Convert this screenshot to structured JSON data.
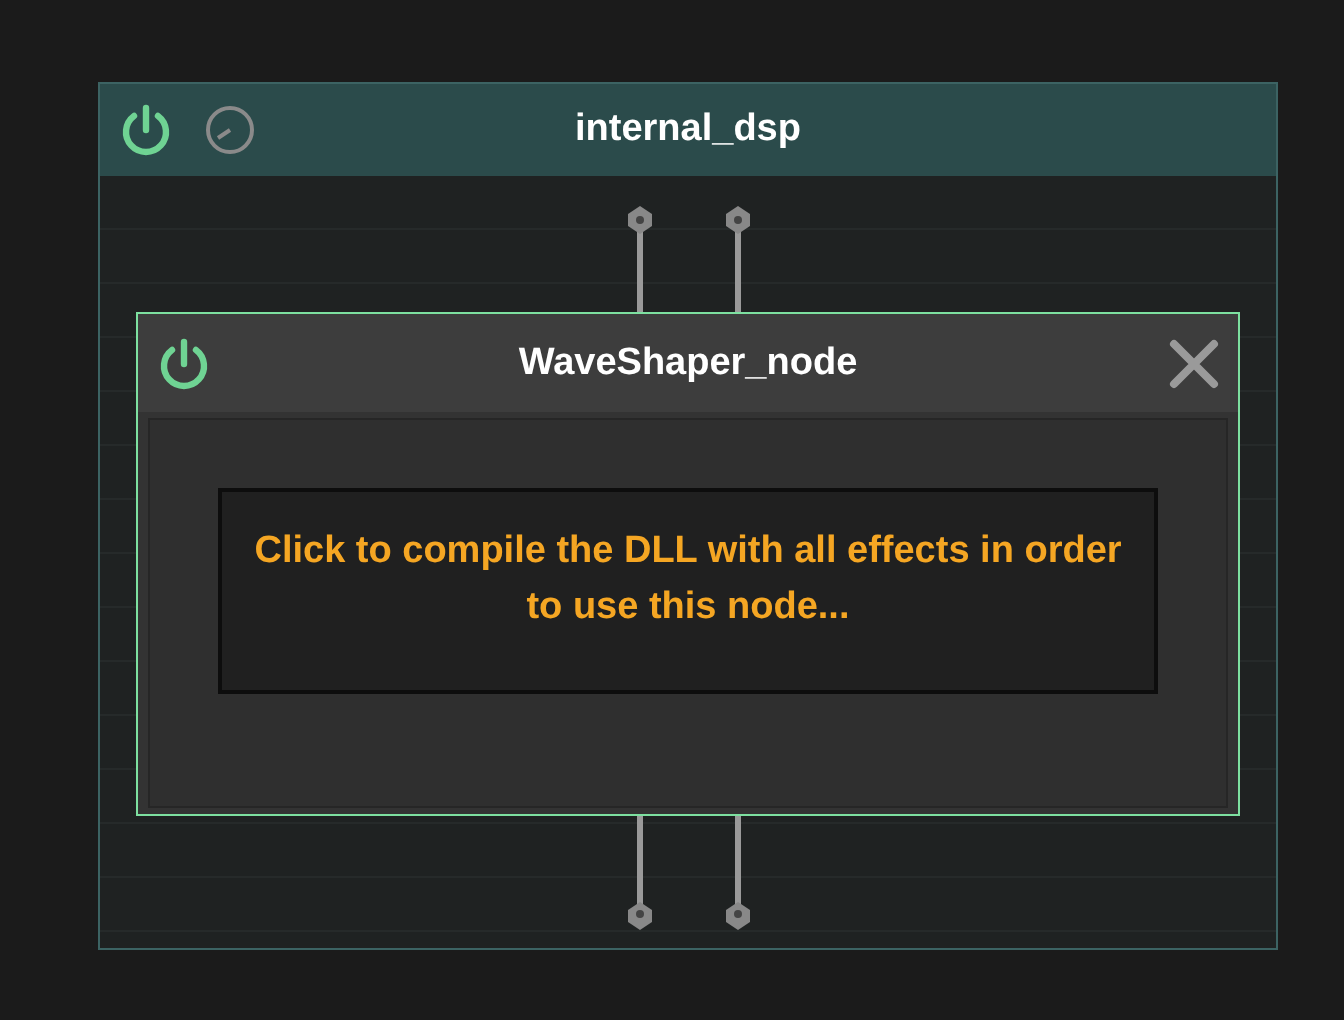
{
  "outer_node": {
    "title": "internal_dsp",
    "enabled": true
  },
  "inner_node": {
    "title": "WaveShaper_node",
    "enabled": true,
    "message": "Click to compile the DLL with all effects in order to use this node..."
  }
}
